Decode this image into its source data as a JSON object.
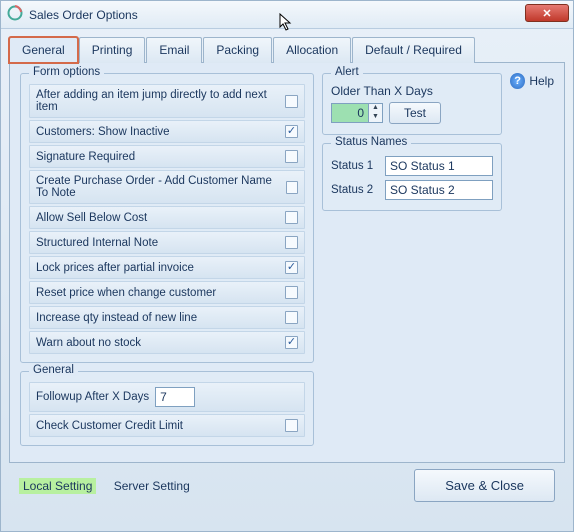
{
  "window": {
    "title": "Sales Order Options"
  },
  "tabs": [
    {
      "label": "General"
    },
    {
      "label": "Printing"
    },
    {
      "label": "Email"
    },
    {
      "label": "Packing"
    },
    {
      "label": "Allocation"
    },
    {
      "label": "Default / Required"
    }
  ],
  "form_options": {
    "title": "Form options",
    "items": [
      {
        "label": "After adding an item jump directly to add next item",
        "checked": false
      },
      {
        "label": "Customers: Show Inactive",
        "checked": true
      },
      {
        "label": "Signature Required",
        "checked": false
      },
      {
        "label": "Create Purchase Order - Add Customer Name To Note",
        "checked": false
      },
      {
        "label": "Allow Sell Below Cost",
        "checked": false
      },
      {
        "label": "Structured Internal Note",
        "checked": false
      },
      {
        "label": "Lock prices after partial invoice",
        "checked": true
      },
      {
        "label": "Reset price when change customer",
        "checked": false
      },
      {
        "label": "Increase qty instead of new line",
        "checked": false
      },
      {
        "label": "Warn about no stock",
        "checked": true
      }
    ]
  },
  "general_group": {
    "title": "General",
    "followup_label": "Followup After X Days",
    "followup_value": "7",
    "credit_label": "Check Customer Credit Limit",
    "credit_checked": false
  },
  "alert": {
    "title": "Alert",
    "older_label": "Older Than X Days",
    "value": "0",
    "test_label": "Test"
  },
  "status_names": {
    "title": "Status Names",
    "rows": [
      {
        "label": "Status 1",
        "value": "SO Status 1"
      },
      {
        "label": "Status 2",
        "value": "SO Status 2"
      }
    ]
  },
  "help_label": "Help",
  "footer": {
    "local": "Local Setting",
    "server": "Server Setting",
    "save": "Save & Close"
  }
}
